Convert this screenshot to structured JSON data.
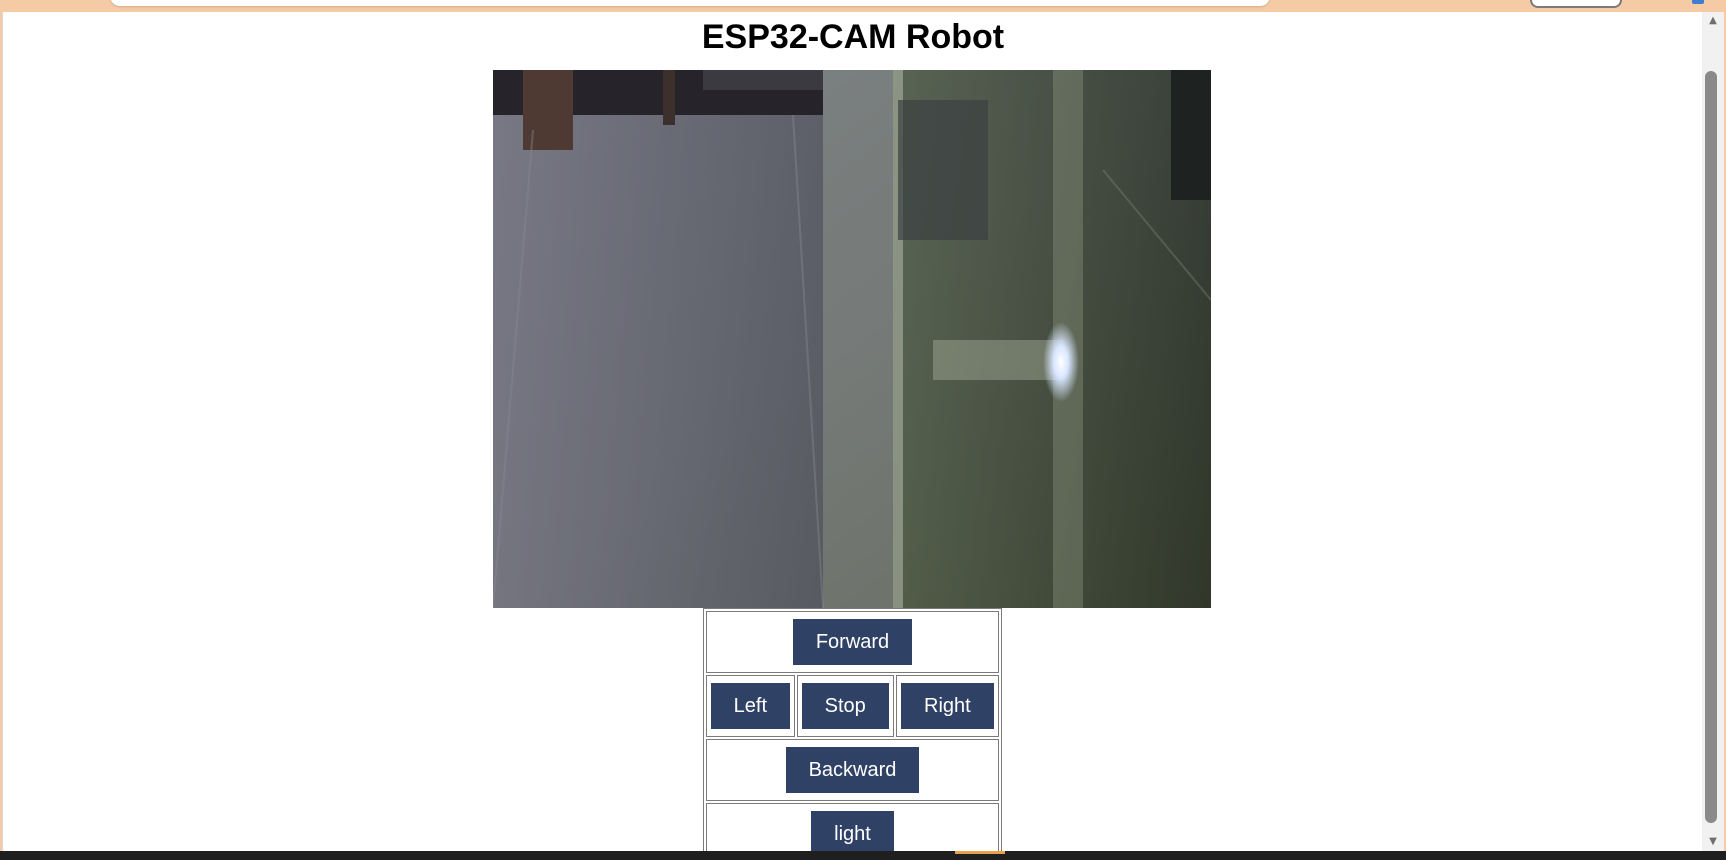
{
  "page": {
    "title": "ESP32-CAM Robot"
  },
  "controls": {
    "forward_label": "Forward",
    "left_label": "Left",
    "stop_label": "Stop",
    "right_label": "Right",
    "backward_label": "Backward",
    "light_label": "light"
  },
  "colors": {
    "button_bg": "#2f4266",
    "button_text": "#ffffff",
    "browser_frame": "#f5cba6"
  }
}
